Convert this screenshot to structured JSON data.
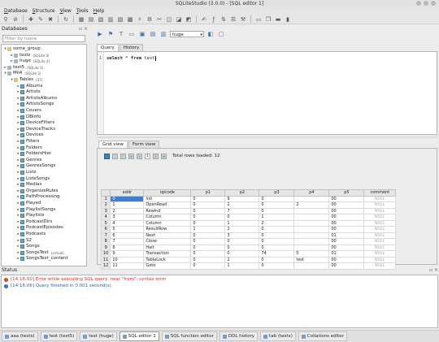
{
  "window": {
    "title": "SQLiteStudio (3.0.0) - [SQL editor 1]"
  },
  "menu": [
    "Database",
    "Structure",
    "View",
    "Tools",
    "Help"
  ],
  "db_panel": {
    "title": "Databases",
    "filter_placeholder": "Filter by name",
    "tree": [
      {
        "level": 0,
        "arrow": "▾",
        "icon": "fold",
        "label": "some_group",
        "sub": ""
      },
      {
        "level": 1,
        "arrow": "▸",
        "icon": "db",
        "label": "tests",
        "sub": "(SQLite 3)"
      },
      {
        "level": 1,
        "arrow": "▸",
        "icon": "db",
        "label": "huge",
        "sub": "(SQLite 3)"
      },
      {
        "level": 0,
        "arrow": "▸",
        "icon": "db",
        "label": "test5",
        "sub": "(SQLite 3)"
      },
      {
        "level": 0,
        "arrow": "▾",
        "icon": "db",
        "label": "Mil4",
        "sub": "(SQLite 3)"
      },
      {
        "level": 1,
        "arrow": "▾",
        "icon": "fold",
        "label": "Tables",
        "sub": "(37)"
      },
      {
        "level": 2,
        "arrow": "▸",
        "icon": "tab",
        "label": "Albums",
        "sub": ""
      },
      {
        "level": 2,
        "arrow": "▸",
        "icon": "tab",
        "label": "Artists",
        "sub": ""
      },
      {
        "level": 2,
        "arrow": "▸",
        "icon": "tab",
        "label": "ArtistsAlbums",
        "sub": ""
      },
      {
        "level": 2,
        "arrow": "▸",
        "icon": "tab",
        "label": "ArtistsSongs",
        "sub": ""
      },
      {
        "level": 2,
        "arrow": "▸",
        "icon": "tab",
        "label": "Covers",
        "sub": ""
      },
      {
        "level": 2,
        "arrow": "▸",
        "icon": "tab",
        "label": "DBInfo",
        "sub": ""
      },
      {
        "level": 2,
        "arrow": "▸",
        "icon": "tab",
        "label": "DeviceFilters",
        "sub": ""
      },
      {
        "level": 2,
        "arrow": "▸",
        "icon": "tab",
        "label": "DeviceTracks",
        "sub": ""
      },
      {
        "level": 2,
        "arrow": "▸",
        "icon": "tab",
        "label": "Devices",
        "sub": ""
      },
      {
        "level": 2,
        "arrow": "▸",
        "icon": "tab",
        "label": "Filters",
        "sub": ""
      },
      {
        "level": 2,
        "arrow": "▸",
        "icon": "tab",
        "label": "Folders",
        "sub": ""
      },
      {
        "level": 2,
        "arrow": "▸",
        "icon": "tab",
        "label": "FoldersHier",
        "sub": ""
      },
      {
        "level": 2,
        "arrow": "▸",
        "icon": "tab",
        "label": "Genres",
        "sub": ""
      },
      {
        "level": 2,
        "arrow": "▸",
        "icon": "tab",
        "label": "GenresSongs",
        "sub": ""
      },
      {
        "level": 2,
        "arrow": "▸",
        "icon": "tab",
        "label": "Lists",
        "sub": ""
      },
      {
        "level": 2,
        "arrow": "▸",
        "icon": "tab",
        "label": "ListsSongs",
        "sub": ""
      },
      {
        "level": 2,
        "arrow": "▸",
        "icon": "tab",
        "label": "Medias",
        "sub": ""
      },
      {
        "level": 2,
        "arrow": "▸",
        "icon": "tab",
        "label": "OrganizeRules",
        "sub": ""
      },
      {
        "level": 2,
        "arrow": "▸",
        "icon": "tab",
        "label": "PathProcessing",
        "sub": ""
      },
      {
        "level": 2,
        "arrow": "▸",
        "icon": "tab",
        "label": "Played",
        "sub": ""
      },
      {
        "level": 2,
        "arrow": "▸",
        "icon": "tab",
        "label": "PlaylistSongs",
        "sub": ""
      },
      {
        "level": 2,
        "arrow": "▸",
        "icon": "tab",
        "label": "Playlists",
        "sub": ""
      },
      {
        "level": 2,
        "arrow": "▸",
        "icon": "tab",
        "label": "PodcastDirs",
        "sub": ""
      },
      {
        "level": 2,
        "arrow": "▸",
        "icon": "tab",
        "label": "PodcastEpisodes",
        "sub": ""
      },
      {
        "level": 2,
        "arrow": "▸",
        "icon": "tab",
        "label": "Podcasts",
        "sub": ""
      },
      {
        "level": 2,
        "arrow": "▸",
        "icon": "tab",
        "label": "S2",
        "sub": ""
      },
      {
        "level": 2,
        "arrow": "▸",
        "icon": "tab",
        "label": "Songs",
        "sub": ""
      },
      {
        "level": 2,
        "arrow": "▸",
        "icon": "tab",
        "label": "SongsText",
        "sub": "(virtual)"
      },
      {
        "level": 2,
        "arrow": "▸",
        "icon": "tab",
        "label": "SongsText_content",
        "sub": ""
      }
    ]
  },
  "editor": {
    "db_combo": "huge",
    "tabs": [
      "Query",
      "History"
    ],
    "line_number": "1",
    "query_keyword1": "select",
    "query_rest": " * ",
    "query_keyword2": "from",
    "query_table": " test",
    "result_tabs": [
      "Grid view",
      "Form view"
    ],
    "page": "1",
    "rows_loaded": "Total rows loaded: 12"
  },
  "grid": {
    "columns": [
      "addr",
      "opcode",
      "p1",
      "p2",
      "p3",
      "p4",
      "p5",
      "comment"
    ],
    "rows": [
      [
        "1",
        "0",
        "Init",
        "0",
        "9",
        "0",
        "",
        "00",
        "NULL"
      ],
      [
        "2",
        "1",
        "OpenRead",
        "0",
        "2",
        "0",
        "2",
        "00",
        "NULL"
      ],
      [
        "3",
        "2",
        "Rewind",
        "0",
        "7",
        "0",
        "",
        "00",
        "NULL"
      ],
      [
        "4",
        "3",
        "Column",
        "0",
        "0",
        "1",
        "",
        "00",
        "NULL"
      ],
      [
        "5",
        "4",
        "Column",
        "0",
        "1",
        "2",
        "",
        "00",
        "NULL"
      ],
      [
        "6",
        "5",
        "ResultRow",
        "1",
        "2",
        "0",
        "",
        "00",
        "NULL"
      ],
      [
        "7",
        "6",
        "Next",
        "0",
        "3",
        "0",
        "",
        "01",
        "NULL"
      ],
      [
        "8",
        "7",
        "Close",
        "0",
        "0",
        "0",
        "",
        "00",
        "NULL"
      ],
      [
        "9",
        "8",
        "Halt",
        "0",
        "0",
        "0",
        "",
        "00",
        "NULL"
      ],
      [
        "10",
        "9",
        "Transaction",
        "0",
        "0",
        "74",
        "0",
        "01",
        "NULL"
      ],
      [
        "11",
        "10",
        "TableLock",
        "0",
        "2",
        "0",
        "test",
        "00",
        "NULL"
      ],
      [
        "12",
        "11",
        "Goto",
        "0",
        "1",
        "0",
        "",
        "00",
        "NULL"
      ]
    ]
  },
  "status": {
    "title": "Status",
    "messages": [
      {
        "type": "error",
        "text": "[14:16:00] Error while executing SQL query: near \"from\": syntax error"
      },
      {
        "type": "info",
        "text": "[14:16:06] Query finished in 0.001 second(s)."
      }
    ]
  },
  "taskbar": [
    "aaa (tests)",
    "test (test5)",
    "test (huge)",
    "SQL editor 1",
    "SQL function editor",
    "DDL history",
    "tab (testx)",
    "Collations editor"
  ],
  "colors": {
    "selection": "#3f7ed0",
    "error": "#c0392b",
    "info": "#2d5fb0"
  }
}
